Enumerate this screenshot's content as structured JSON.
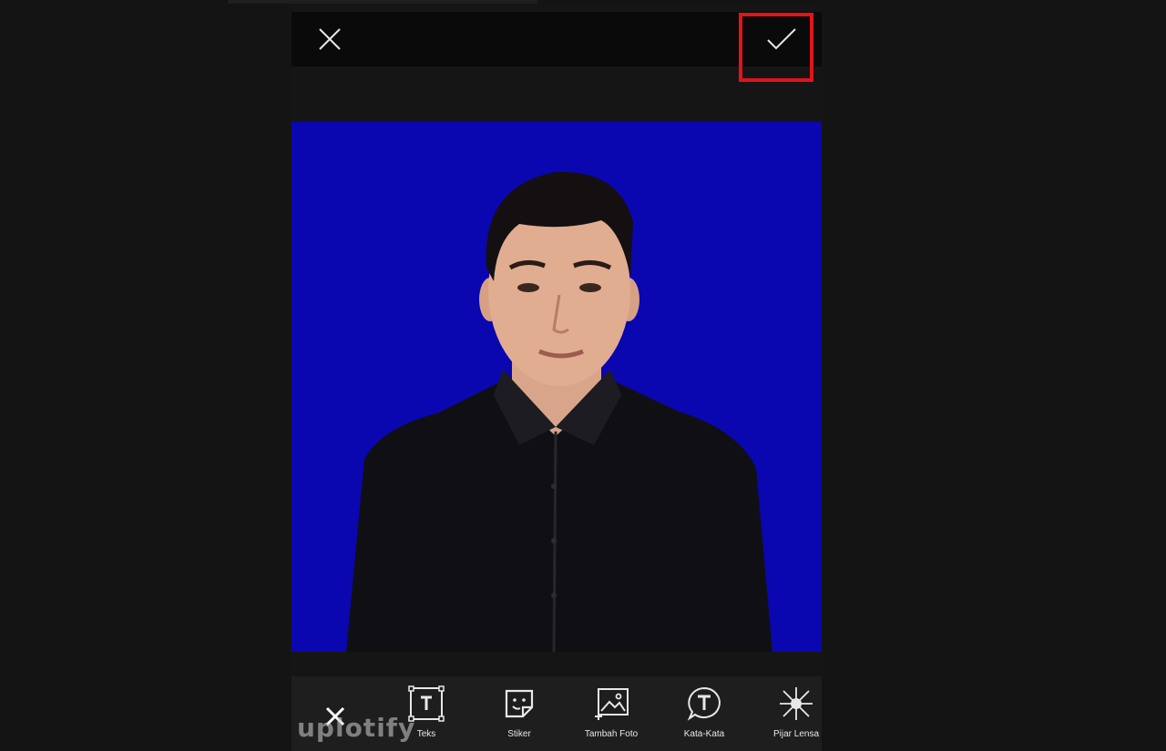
{
  "topbar": {
    "close_icon": "close-icon",
    "confirm_icon": "check-icon",
    "highlight_color": "#e0141a"
  },
  "photo": {
    "background_color": "#0a07b0",
    "subject": "portrait-person-black-shirt"
  },
  "toolbar": {
    "close_icon": "close-icon",
    "items": [
      {
        "label": "Teks",
        "icon": "text-box-icon"
      },
      {
        "label": "Stiker",
        "icon": "sticker-icon"
      },
      {
        "label": "Tambah Foto",
        "icon": "add-photo-icon"
      },
      {
        "label": "Kata-Kata",
        "icon": "speech-bubble-icon"
      },
      {
        "label": "Pijar Lensa",
        "icon": "lens-flare-icon"
      }
    ]
  },
  "watermark": {
    "text": "uplotify"
  }
}
